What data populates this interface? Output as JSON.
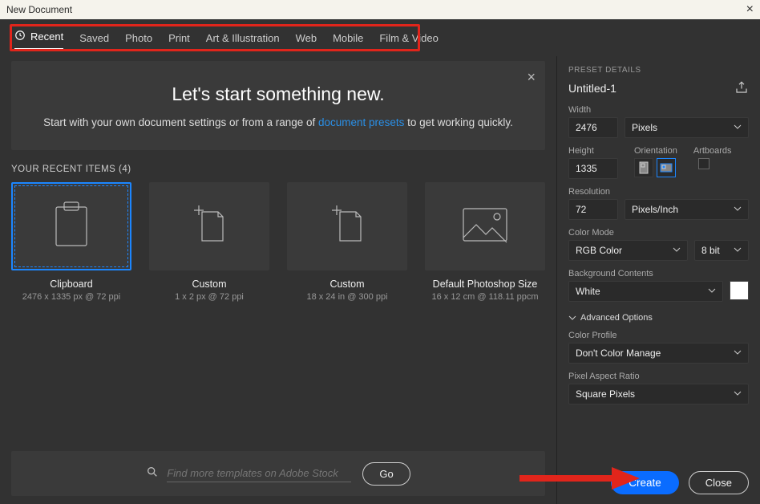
{
  "window": {
    "title": "New Document"
  },
  "tabs": [
    "Recent",
    "Saved",
    "Photo",
    "Print",
    "Art & Illustration",
    "Web",
    "Mobile",
    "Film & Video"
  ],
  "intro": {
    "heading": "Let's start something new.",
    "text_before": "Start with your own document settings or from a range of ",
    "link_text": "document presets",
    "text_after": " to get working quickly."
  },
  "recent": {
    "label": "YOUR RECENT ITEMS  (4)",
    "items": [
      {
        "name": "Clipboard",
        "meta": "2476 x 1335 px @ 72 ppi",
        "icon": "clipboard"
      },
      {
        "name": "Custom",
        "meta": "1 x 2 px @ 72 ppi",
        "icon": "file-plus"
      },
      {
        "name": "Custom",
        "meta": "18 x 24 in @ 300 ppi",
        "icon": "file-plus"
      },
      {
        "name": "Default Photoshop Size",
        "meta": "16 x 12 cm @ 118.11 ppcm",
        "icon": "image"
      }
    ]
  },
  "search": {
    "placeholder": "Find more templates on Adobe Stock",
    "go": "Go"
  },
  "preset": {
    "section": "Preset Details",
    "doc_name": "Untitled-1",
    "width_label": "Width",
    "width_value": "2476",
    "width_unit": "Pixels",
    "height_label": "Height",
    "height_value": "1335",
    "orientation_label": "Orientation",
    "artboards_label": "Artboards",
    "resolution_label": "Resolution",
    "resolution_value": "72",
    "resolution_unit": "Pixels/Inch",
    "colormode_label": "Color Mode",
    "colormode_value": "RGB Color",
    "bitdepth_value": "8 bit",
    "bg_label": "Background Contents",
    "bg_value": "White",
    "advanced": "Advanced Options",
    "profile_label": "Color Profile",
    "profile_value": "Don't Color Manage",
    "par_label": "Pixel Aspect Ratio",
    "par_value": "Square Pixels"
  },
  "buttons": {
    "create": "Create",
    "close": "Close"
  }
}
